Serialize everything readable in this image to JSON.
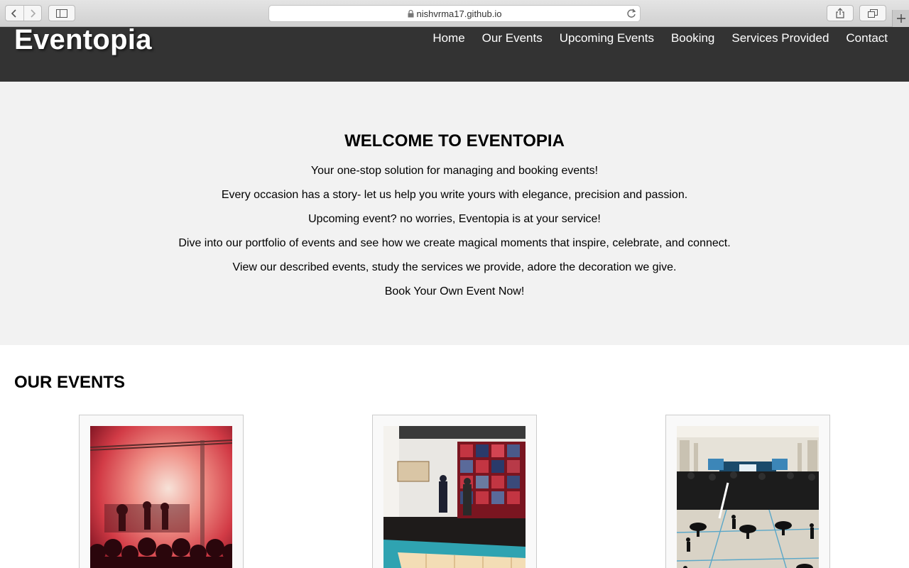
{
  "browser": {
    "url": "nishvrma17.github.io"
  },
  "header": {
    "logo": "Eventopia",
    "nav": [
      {
        "label": "Home"
      },
      {
        "label": "Our Events"
      },
      {
        "label": "Upcoming Events"
      },
      {
        "label": "Booking"
      },
      {
        "label": "Services Provided"
      },
      {
        "label": "Contact"
      }
    ]
  },
  "hero": {
    "title": "WELCOME TO EVENTOPIA",
    "lines": [
      "Your one-stop solution for managing and booking events!",
      "Every occasion has a story- let us help you write yours with elegance, precision and passion.",
      "Upcoming event? no worries, Eventopia is at your service!",
      "Dive into our portfolio of events and see how we create magical moments that inspire, celebrate, and connect.",
      "View our described events, study the services we provide, adore the decoration we give.",
      "Book Your Own Event Now!"
    ]
  },
  "events": {
    "title": "OUR EVENTS"
  },
  "colors": {
    "header_bg": "#333333",
    "hero_bg": "#f2f2f2"
  }
}
